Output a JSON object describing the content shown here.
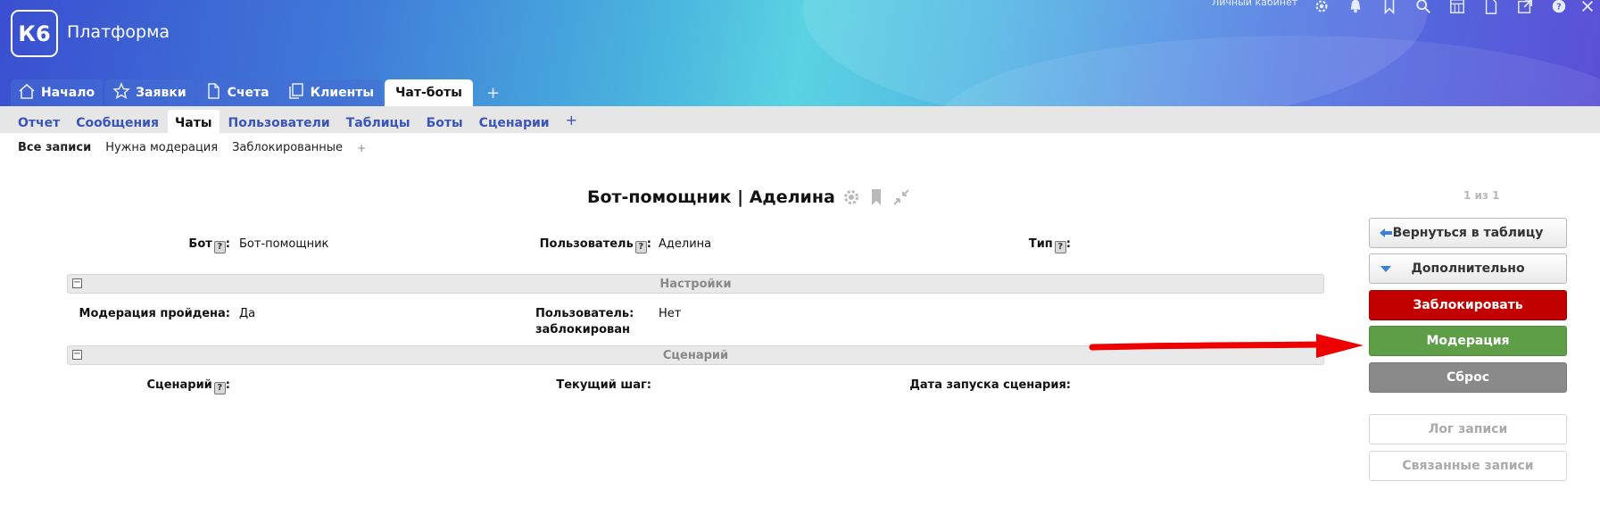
{
  "header": {
    "logo_text": "К6",
    "app_title": "Платформа",
    "user_link": "Личный кабинет",
    "top_icons": [
      "gear-icon",
      "bell-icon",
      "bookmark-icon",
      "search-icon",
      "calculator-icon",
      "document-icon",
      "external-link-icon",
      "help-icon",
      "close-icon"
    ]
  },
  "main_tabs": [
    {
      "label": "Начало",
      "icon": "home-icon"
    },
    {
      "label": "Заявки",
      "icon": "star-icon"
    },
    {
      "label": "Счета",
      "icon": "document-icon"
    },
    {
      "label": "Клиенты",
      "icon": "copy-icon"
    },
    {
      "label": "Чат-боты",
      "active": true
    }
  ],
  "main_tab_add": "+",
  "sub_tabs": [
    {
      "label": "Отчет"
    },
    {
      "label": "Сообщения"
    },
    {
      "label": "Чаты",
      "active": true
    },
    {
      "label": "Пользователи"
    },
    {
      "label": "Таблицы"
    },
    {
      "label": "Боты"
    },
    {
      "label": "Сценарии"
    }
  ],
  "sub_tab_add": "+",
  "filters": [
    {
      "label": "Все записи",
      "active": true
    },
    {
      "label": "Нужна модерация"
    },
    {
      "label": "Заблокированные"
    }
  ],
  "filter_add": "+",
  "record": {
    "title": "Бот-помощник | Аделина",
    "pager": "1 из 1"
  },
  "fields": {
    "bot_label": "Бот",
    "bot_value": "Бот-помощник",
    "user_label": "Пользователь",
    "user_value": "Аделина",
    "type_label": "Тип",
    "help_mark": "?",
    "colon": ":"
  },
  "sections": {
    "settings": {
      "title": "Настройки",
      "toggle": "−",
      "moderation_label": "Модерация пройдена:",
      "moderation_value": "Да",
      "blocked_label_line1": "Пользователь:",
      "blocked_label_line2": "заблокирован",
      "blocked_value": "Нет"
    },
    "scenario": {
      "title": "Сценарий",
      "toggle": "−",
      "scenario_label": "Сценарий",
      "current_step_label": "Текущий шаг:",
      "start_date_label": "Дата запуска сценария:"
    }
  },
  "side_buttons": {
    "back": "Вернуться в таблицу",
    "more": "Дополнительно",
    "block": "Заблокировать",
    "moderate": "Модерация",
    "reset": "Сброс",
    "log": "Лог записи",
    "related": "Связанные записи"
  },
  "colors": {
    "block": "#c20000",
    "moderate": "#5e9e47",
    "reset": "#8a8a8a",
    "arrow": "#ee0000",
    "link": "#3a55b6"
  }
}
